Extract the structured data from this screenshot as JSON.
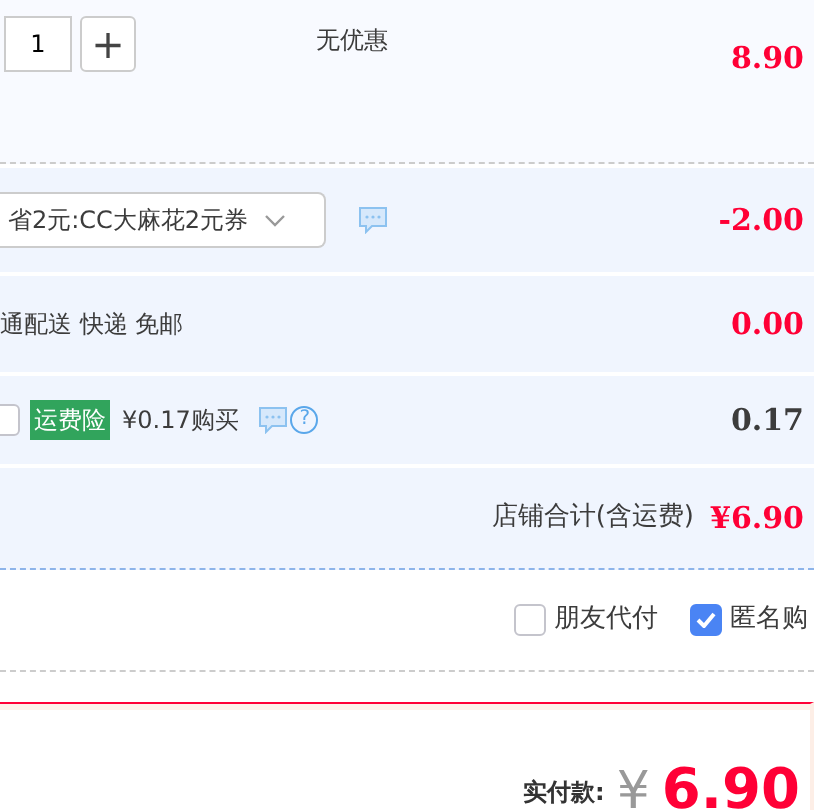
{
  "item": {
    "quantity": "1",
    "plus": "+",
    "discount": "无优惠",
    "price": "8.90"
  },
  "coupon": {
    "value": "省2元:CC大麻花2元券",
    "amount": "-2.00"
  },
  "shipping": {
    "text": "通配送 快递 免邮",
    "amount": "0.00"
  },
  "insurance": {
    "checked": false,
    "tag": "运费险",
    "offer": "¥0.17购买",
    "help": "?",
    "amount": "0.17"
  },
  "store_total": {
    "label": "店铺合计(含运费)",
    "amount": "¥6.90"
  },
  "options": [
    {
      "label": "朋友代付",
      "checked": false
    },
    {
      "label": "匿名购",
      "checked": true
    }
  ],
  "payment": {
    "label": "实付款:",
    "currency": "¥",
    "amount": "6.90"
  }
}
